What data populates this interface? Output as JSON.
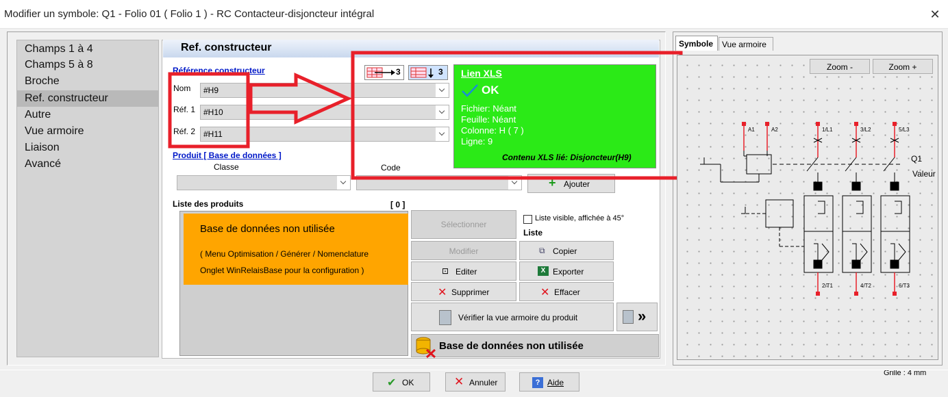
{
  "window": {
    "title": "Modifier un symbole: Q1 - Folio 01 ( Folio 1 ) - RC Contacteur-disjoncteur intégral",
    "close": "✕"
  },
  "nav": {
    "items": [
      "Champs 1 à 4",
      "Champs 5 à 8",
      "Broche",
      "Ref. constructeur",
      "Autre",
      "Vue armoire",
      "Liaison",
      "Avancé"
    ],
    "selected": "Ref. constructeur"
  },
  "section_title": "Ref. constructeur",
  "ref": {
    "heading": "Référence constructeur",
    "nom_label": "Nom",
    "nom_value": "#H9",
    "ref1_label": "Réf. 1",
    "ref1_value": "#H10",
    "ref2_label": "Réf. 2",
    "ref2_value": "#H11",
    "icon_right_label": "3",
    "icon_down_label": "3"
  },
  "xls": {
    "title": "Lien XLS",
    "status": "OK",
    "fichier": "Fichier: Néant",
    "feuille": "Feuille: Néant",
    "colonne": "Colonne: H ( 7 )",
    "ligne": "Ligne: 9",
    "contenu": "Contenu XLS lié: Disjoncteur(H9)"
  },
  "produit": {
    "heading": "Produit [ Base de données ]",
    "classe_label": "Classe",
    "code_label": "Code",
    "ajouter": "Ajouter"
  },
  "liste": {
    "heading": "Liste des produits",
    "count": "[ 0 ]",
    "db_title": "Base de données non utilisée",
    "db_line1": "( Menu Optimisation / Générer / Nomenclature",
    "db_line2": "Onglet WinRelaisBase pour la configuration )",
    "checkbox_label": "Liste visible, affichée à 45°",
    "liste_label": "Liste"
  },
  "buttons": {
    "selectionner": "Sélectionner",
    "modifier": "Modifier",
    "copier": "Copier",
    "editer": "Editer",
    "exporter": "Exporter",
    "supprimer": "Supprimer",
    "effacer": "Effacer",
    "verifier": "Vérifier la vue armoire du produit",
    "db_status": "Base de données non utilisée"
  },
  "right": {
    "tab_symbole": "Symbole",
    "tab_vue": "Vue armoire",
    "zoom_minus": "Zoom -",
    "zoom_plus": "Zoom +",
    "grid": "Grille : 4 mm",
    "sym": {
      "a1": "A1",
      "a2": "A2",
      "l1": "1/L1",
      "l2": "3/L2",
      "l3": "5/L3",
      "t1": "2/T1",
      "t2": "4/T2",
      "t3": "6/T3",
      "q1": "Q1",
      "valeur": "Valeur"
    }
  },
  "footer": {
    "ok": "OK",
    "annuler": "Annuler",
    "aide": "Aide"
  },
  "colors": {
    "highlight_red": "#e8202a",
    "xls_green": "#2bea17",
    "db_orange": "#ffa500",
    "link_blue": "#0018c8"
  }
}
